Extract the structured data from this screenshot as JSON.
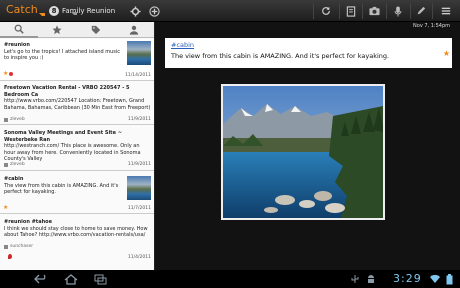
{
  "app": {
    "title": "Catch",
    "space_badge": "8",
    "space_name": "Family Reunion"
  },
  "actionbar": {
    "icons": [
      "gear-icon",
      "add-circle-icon",
      "refresh-icon",
      "note-icon",
      "camera-icon",
      "microphone-icon",
      "pencil-icon",
      "menu-icon"
    ]
  },
  "tabs": [
    "search-icon",
    "star-icon",
    "tag-icon",
    "person-icon"
  ],
  "notes": [
    {
      "title": "#reunion",
      "lines": [
        "Let's go to the tropics!   I attached island music",
        "to inspire you :)"
      ],
      "date": "11/14/2011",
      "has_thumb": true,
      "starred": true,
      "source": ""
    },
    {
      "title": "Freetown Vacation Rental - VRBO 220547 - 5 Bedroom Ca",
      "lines": [
        "http://www.vrbo.com/220547  Location: Freetown, Grand",
        "Bahama, Bahamas, Caribbean (30 Min East from Freeport)"
      ],
      "date": "11/9/2011",
      "has_thumb": false,
      "starred": false,
      "source": "zleveb"
    },
    {
      "title": "Sonoma Valley Meetings and Event Site ~ Westerbeke Ran",
      "lines": [
        "http://westranch.com/  This place is awesome.  Only an",
        "hour away from here.  Conveniently located in Sonoma County's Valley"
      ],
      "date": "11/9/2011",
      "has_thumb": false,
      "starred": false,
      "source": "zleveb"
    },
    {
      "title": "#cabin",
      "lines": [
        "The view from this cabin is AMAZING. And it's",
        "perfect for kayaking."
      ],
      "date": "11/7/2011",
      "has_thumb": true,
      "starred": true,
      "source": ""
    },
    {
      "title": "#reunion #tahoe",
      "lines": [
        "I think we should stay close to home to save money.  How",
        "about Tahoe? http://www.vrbo.com/vacation-rentals/usa/"
      ],
      "date": "11/4/2011",
      "has_thumb": false,
      "starred": false,
      "source": "sunchaser"
    }
  ],
  "detail": {
    "date": "Nov 7, 1:54pm",
    "tag": "#cabin",
    "body": "The view from this cabin is AMAZING. And it's perfect for kayaking."
  },
  "system": {
    "clock": "3:29",
    "nav_icons": [
      "back-icon",
      "home-icon",
      "recent-apps-icon"
    ],
    "status_icons": [
      "usb-icon",
      "android-icon",
      "wifi-icon",
      "battery-icon"
    ]
  },
  "colors": {
    "accent": "#f08b1d",
    "link": "#2a5ebd",
    "clock": "#7ec8f0"
  }
}
